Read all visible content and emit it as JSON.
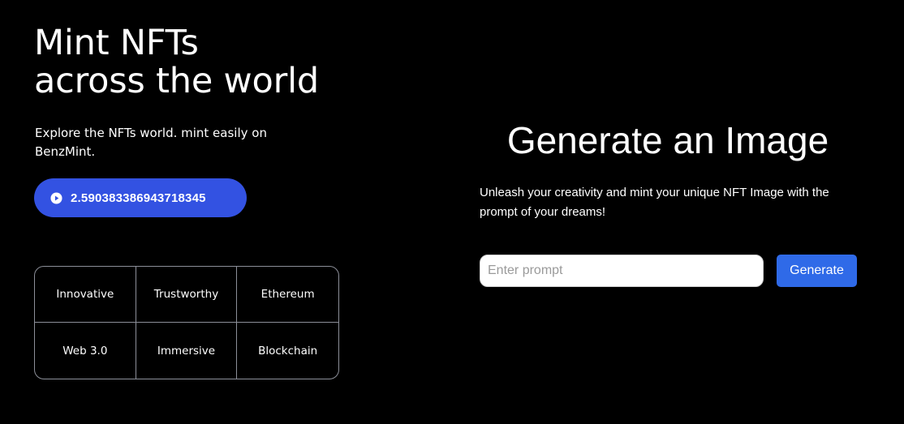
{
  "hero": {
    "title_line1": "Mint NFTs",
    "title_line2": "across the world",
    "subtitle": "Explore the NFTs world. mint easily on BenzMint.",
    "balance_value": "2.590383386943718345",
    "balance_icon": "play-circle-icon",
    "accent_color": "#3352e2"
  },
  "features": [
    "Innovative",
    "Trustworthy",
    "Ethereum",
    "Web 3.0",
    "Immersive",
    "Blockchain"
  ],
  "generator": {
    "title": "Generate an Image",
    "description": "Unleash your creativity and mint your unique NFT Image with the prompt of your dreams!",
    "prompt_placeholder": "Enter prompt",
    "prompt_value": "",
    "generate_label": "Generate",
    "button_color": "#2f6ae8"
  }
}
